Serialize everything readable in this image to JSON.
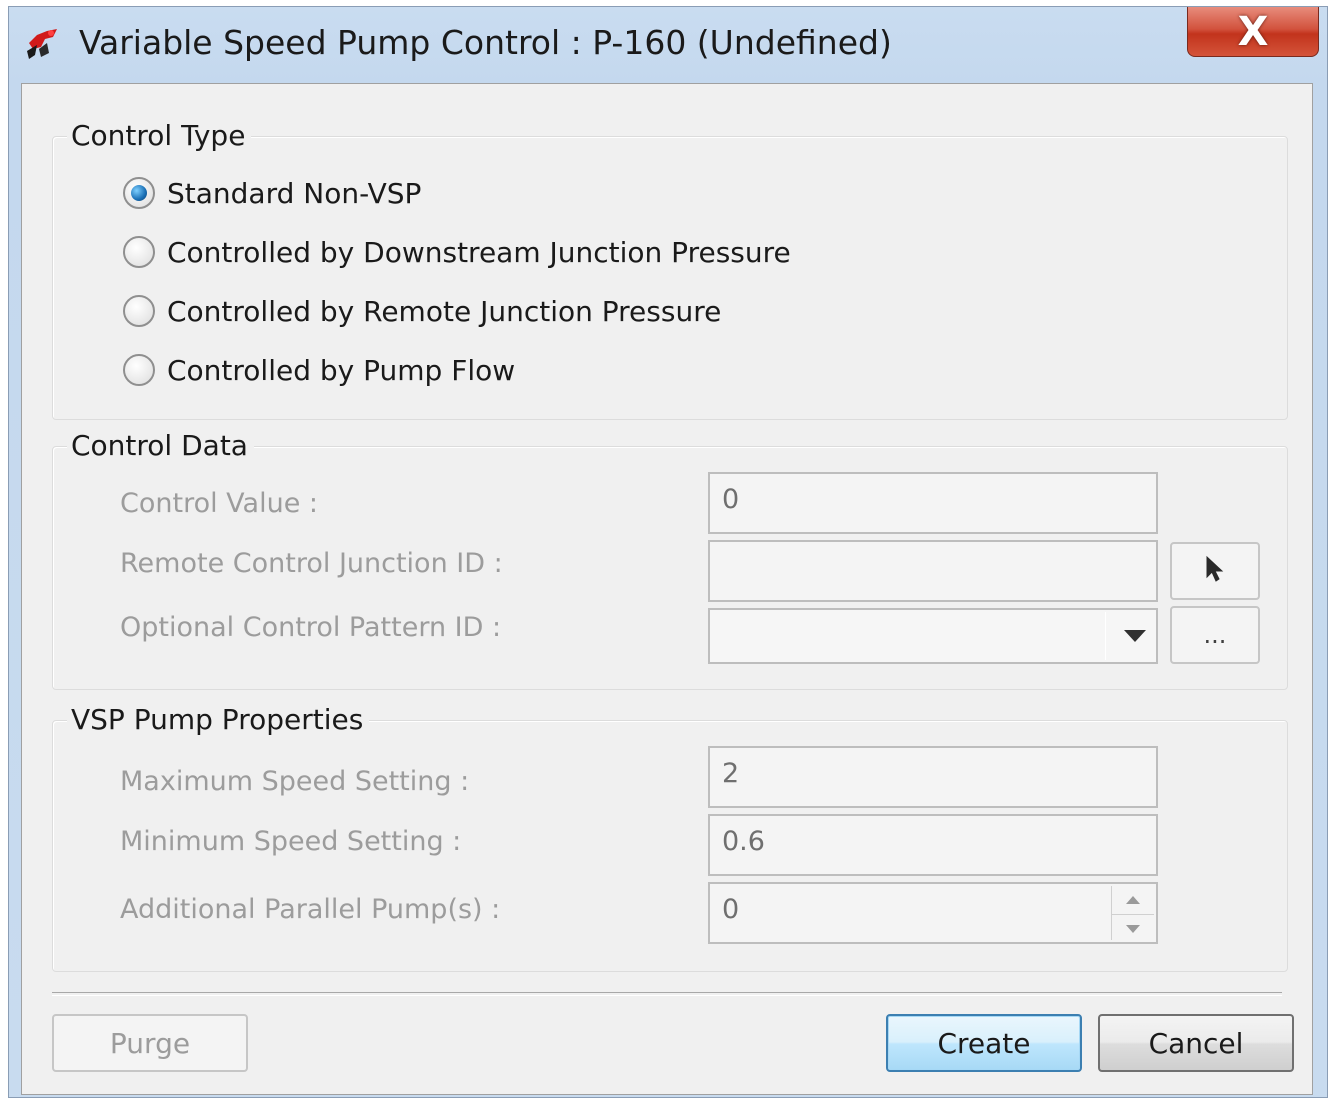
{
  "window": {
    "title": "Variable Speed Pump Control :  P-160 (Undefined)",
    "close_label": "X",
    "app_icon": "pump-app-icon"
  },
  "control_type": {
    "title": "Control Type",
    "options": [
      {
        "label": "Standard Non-VSP",
        "checked": true
      },
      {
        "label": "Controlled by Downstream Junction Pressure",
        "checked": false
      },
      {
        "label": "Controlled by Remote Junction Pressure",
        "checked": false
      },
      {
        "label": "Controlled by Pump Flow",
        "checked": false
      }
    ]
  },
  "control_data": {
    "title": "Control Data",
    "control_value_label": "Control Value :",
    "control_value": "0",
    "remote_junction_label": "Remote Control Junction ID :",
    "remote_junction_value": "",
    "pick_icon": "pointer-arrow-icon",
    "pattern_label": "Optional Control Pattern ID :",
    "pattern_value": "",
    "browse_label": "..."
  },
  "vsp_properties": {
    "title": "VSP Pump Properties",
    "max_speed_label": "Maximum Speed Setting :",
    "max_speed_value": "2",
    "min_speed_label": "Minimum Speed Setting :",
    "min_speed_value": "0.6",
    "parallel_label": "Additional Parallel Pump(s) :",
    "parallel_value": "0"
  },
  "buttons": {
    "purge": "Purge",
    "create": "Create",
    "cancel": "Cancel"
  }
}
